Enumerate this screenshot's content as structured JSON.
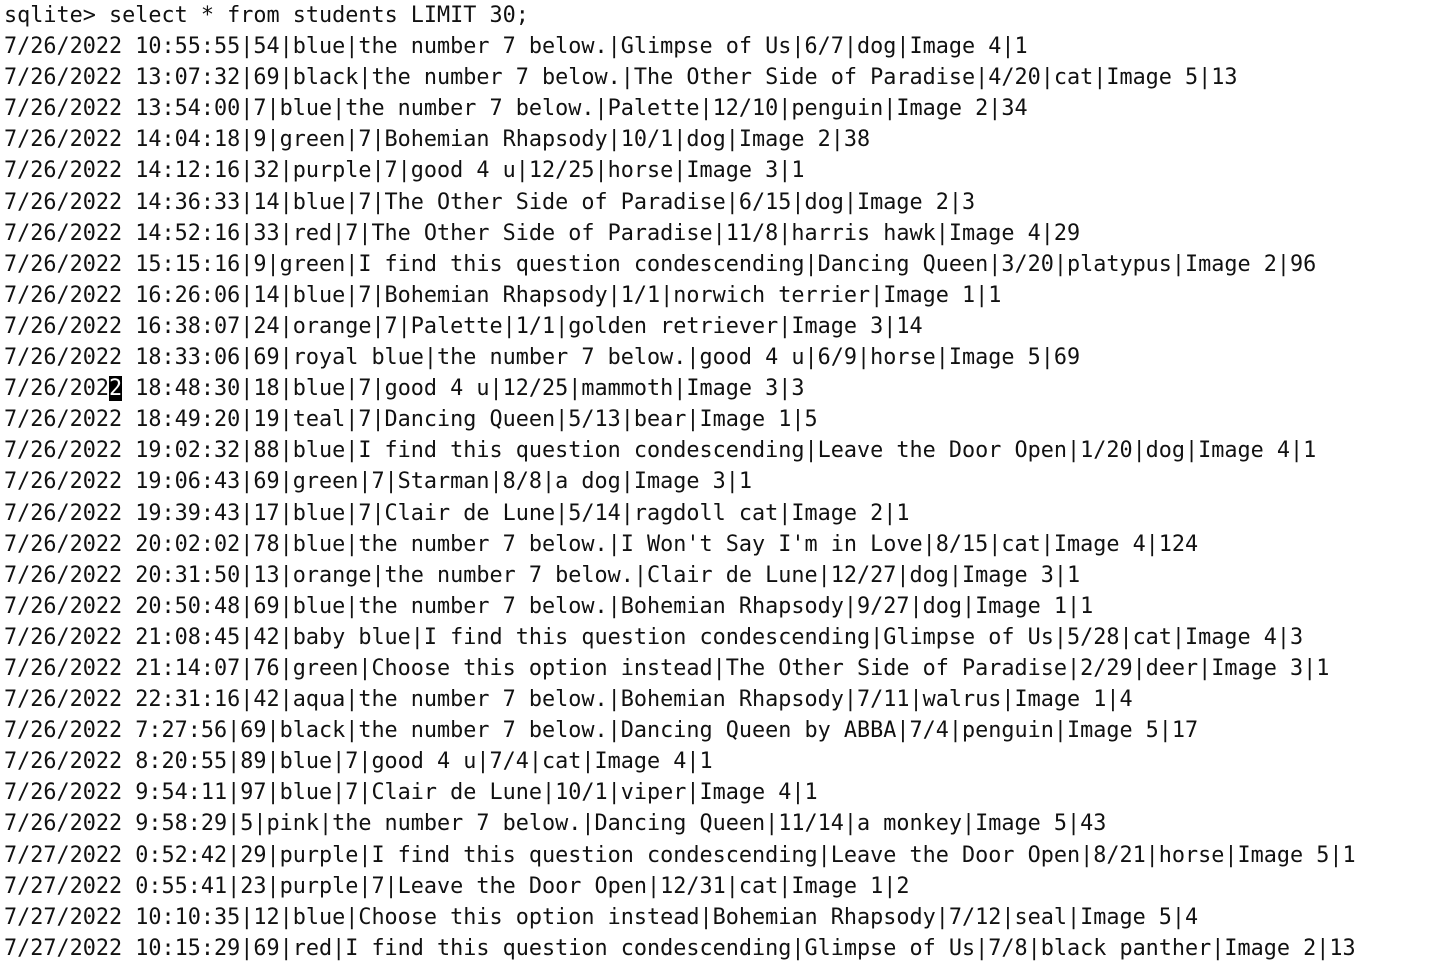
{
  "terminal": {
    "prompt": "sqlite> ",
    "command": "select * from students LIMIT 30;",
    "cursor_row_index": 11,
    "cursor_char": "2",
    "rows": [
      "7/26/2022 10:55:55|54|blue|the number 7 below.|Glimpse of Us|6/7|dog|Image 4|1",
      "7/26/2022 13:07:32|69|black|the number 7 below.|The Other Side of Paradise|4/20|cat|Image 5|13",
      "7/26/2022 13:54:00|7|blue|the number 7 below.|Palette|12/10|penguin|Image 2|34",
      "7/26/2022 14:04:18|9|green|7|Bohemian Rhapsody|10/1|dog|Image 2|38",
      "7/26/2022 14:12:16|32|purple|7|good 4 u|12/25|horse|Image 3|1",
      "7/26/2022 14:36:33|14|blue|7|The Other Side of Paradise|6/15|dog|Image 2|3",
      "7/26/2022 14:52:16|33|red|7|The Other Side of Paradise|11/8|harris hawk|Image 4|29",
      "7/26/2022 15:15:16|9|green|I find this question condescending|Dancing Queen|3/20|platypus|Image 2|96",
      "7/26/2022 16:26:06|14|blue|7|Bohemian Rhapsody|1/1|norwich terrier|Image 1|1",
      "7/26/2022 16:38:07|24|orange|7|Palette|1/1|golden retriever|Image 3|14",
      "7/26/2022 18:33:06|69|royal blue|the number 7 below.|good 4 u|6/9|horse|Image 5|69",
      "7/26/2022 18:48:30|18|blue|7|good 4 u|12/25|mammoth|Image 3|3",
      "7/26/2022 18:49:20|19|teal|7|Dancing Queen|5/13|bear|Image 1|5",
      "7/26/2022 19:02:32|88|blue|I find this question condescending|Leave the Door Open|1/20|dog|Image 4|1",
      "7/26/2022 19:06:43|69|green|7|Starman|8/8|a dog|Image 3|1",
      "7/26/2022 19:39:43|17|blue|7|Clair de Lune|5/14|ragdoll cat|Image 2|1",
      "7/26/2022 20:02:02|78|blue|the number 7 below.|I Won't Say I'm in Love|8/15|cat|Image 4|124",
      "7/26/2022 20:31:50|13|orange|the number 7 below.|Clair de Lune|12/27|dog|Image 3|1",
      "7/26/2022 20:50:48|69|blue|the number 7 below.|Bohemian Rhapsody|9/27|dog|Image 1|1",
      "7/26/2022 21:08:45|42|baby blue|I find this question condescending|Glimpse of Us|5/28|cat|Image 4|3",
      "7/26/2022 21:14:07|76|green|Choose this option instead|The Other Side of Paradise|2/29|deer|Image 3|1",
      "7/26/2022 22:31:16|42|aqua|the number 7 below.|Bohemian Rhapsody|7/11|walrus|Image 1|4",
      "7/26/2022 7:27:56|69|black|the number 7 below.|Dancing Queen by ABBA|7/4|penguin|Image 5|17",
      "7/26/2022 8:20:55|89|blue|7|good 4 u|7/4|cat|Image 4|1",
      "7/26/2022 9:54:11|97|blue|7|Clair de Lune|10/1|viper|Image 4|1",
      "7/26/2022 9:58:29|5|pink|the number 7 below.|Dancing Queen|11/14|a monkey|Image 5|43",
      "7/27/2022 0:52:42|29|purple|I find this question condescending|Leave the Door Open|8/21|horse|Image 5|1",
      "7/27/2022 0:55:41|23|purple|7|Leave the Door Open|12/31|cat|Image 1|2",
      "7/27/2022 10:10:35|12|blue|Choose this option instead|Bohemian Rhapsody|7/12|seal|Image 5|4",
      "7/27/2022 10:15:29|69|red|I find this question condescending|Glimpse of Us|7/8|black panther|Image 2|13"
    ]
  }
}
